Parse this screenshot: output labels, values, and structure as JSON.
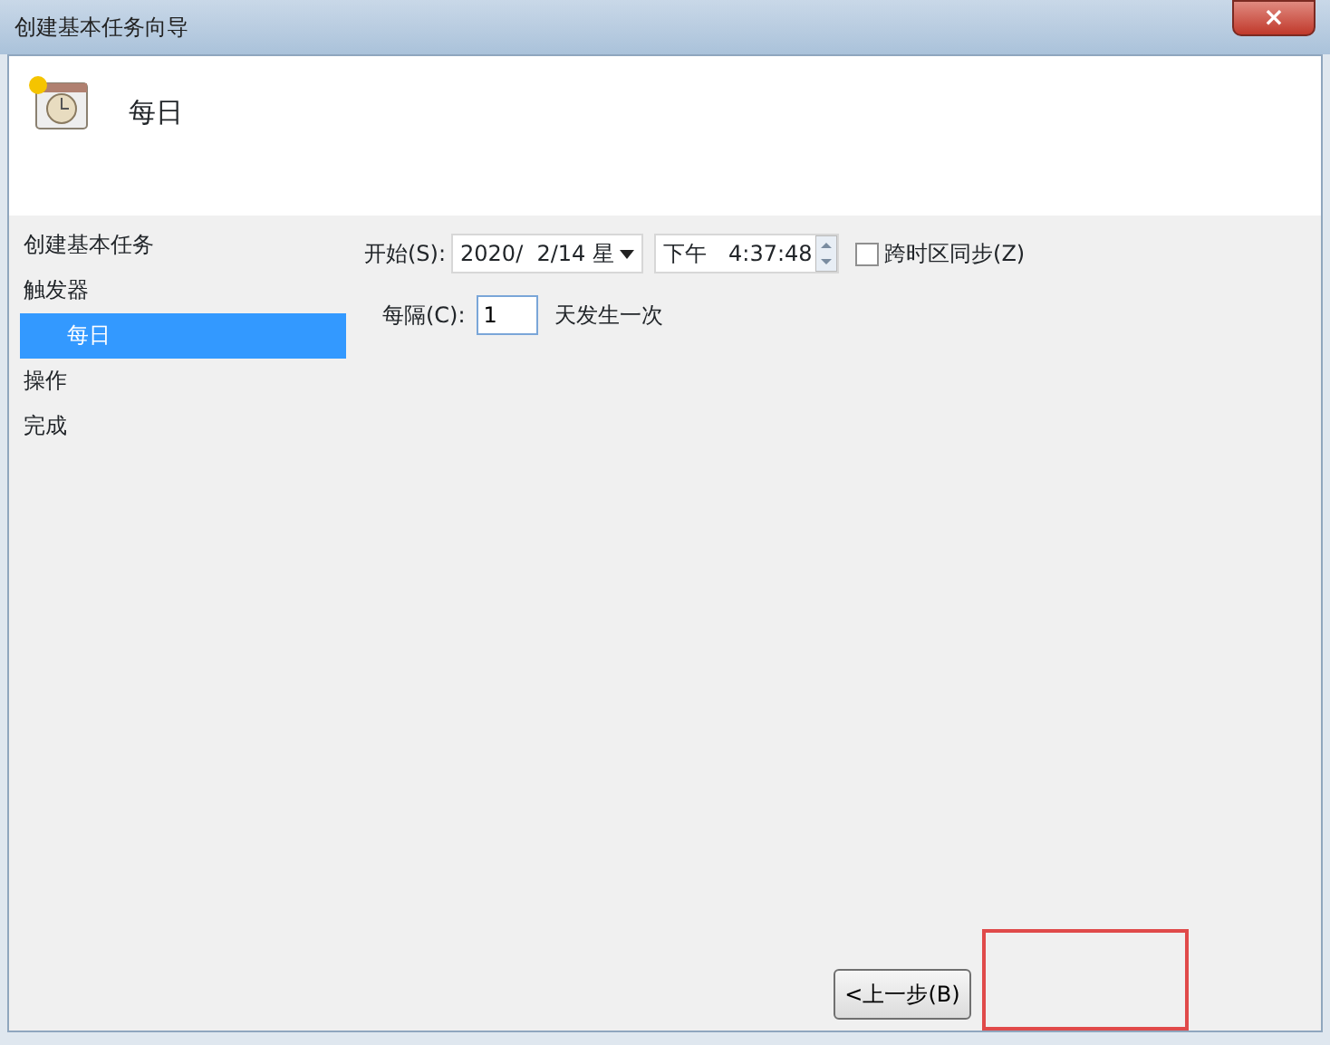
{
  "window": {
    "title": "创建基本任务向导",
    "close": "×"
  },
  "header": {
    "title": "每日"
  },
  "sidebar": {
    "items": [
      {
        "label": "创建基本任务",
        "selected": false
      },
      {
        "label": "触发器",
        "selected": false,
        "children": [
          {
            "label": "每日",
            "selected": true
          }
        ]
      },
      {
        "label": "操作",
        "selected": false
      },
      {
        "label": "完成",
        "selected": false
      }
    ]
  },
  "start": {
    "label": "开始(S):",
    "date": "2020/  2/14 星",
    "meridiem": "下午",
    "time": "4:37:48",
    "sync_label": "跨时区同步(Z)",
    "sync_checked": false
  },
  "recur": {
    "label": "每隔(C):",
    "value": "1",
    "suffix": "天发生一次"
  },
  "buttons": [
    {
      "label": "<上一步(B)"
    }
  ]
}
